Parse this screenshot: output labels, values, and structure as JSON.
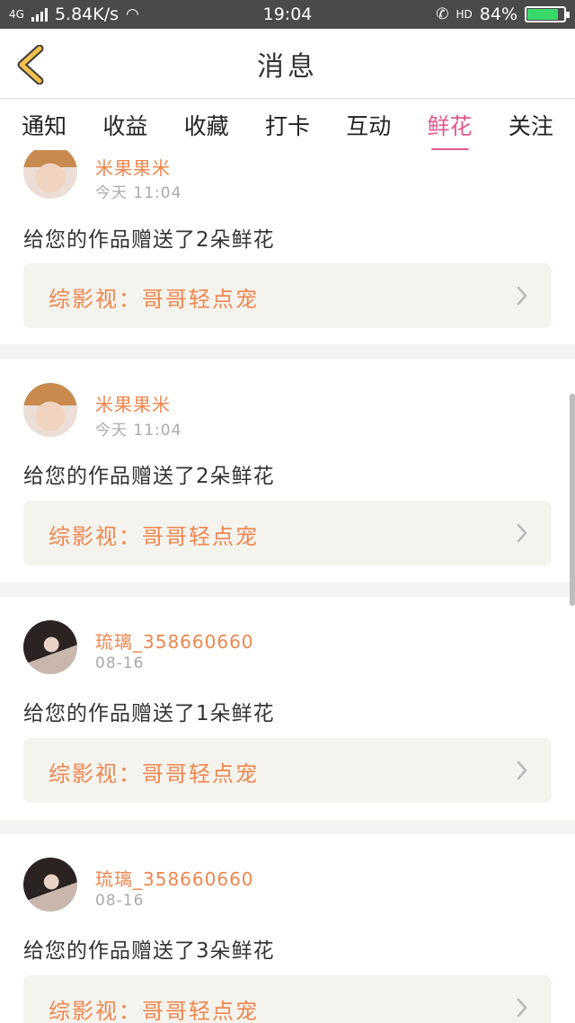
{
  "status_bar": {
    "network": "4G",
    "speed": "5.84K/s",
    "time": "19:04",
    "hd": "HD",
    "battery": "84%",
    "battery_level": 0.84
  },
  "header": {
    "title": "消息"
  },
  "tabs": [
    {
      "label": "通知",
      "active": false
    },
    {
      "label": "收益",
      "active": false
    },
    {
      "label": "收藏",
      "active": false
    },
    {
      "label": "打卡",
      "active": false
    },
    {
      "label": "互动",
      "active": false
    },
    {
      "label": "鲜花",
      "active": true
    },
    {
      "label": "关注",
      "active": false
    }
  ],
  "messages": [
    {
      "user": "米果果米",
      "time": "今天 11:04",
      "text": "给您的作品赠送了2朵鲜花",
      "work": "综影视：哥哥轻点宠"
    },
    {
      "user": "米果果米",
      "time": "今天 11:04",
      "text": "给您的作品赠送了2朵鲜花",
      "work": "综影视：哥哥轻点宠"
    },
    {
      "user": "琉璃_358660660",
      "time": "08-16",
      "text": "给您的作品赠送了1朵鲜花",
      "work": "综影视：哥哥轻点宠"
    },
    {
      "user": "琉璃_358660660",
      "time": "08-16",
      "text": "给您的作品赠送了3朵鲜花",
      "work": "综影视：哥哥轻点宠"
    }
  ],
  "colors": {
    "accent": "#e05a8f",
    "username": "#f0864e",
    "back_arrow": "#f2c14e"
  }
}
